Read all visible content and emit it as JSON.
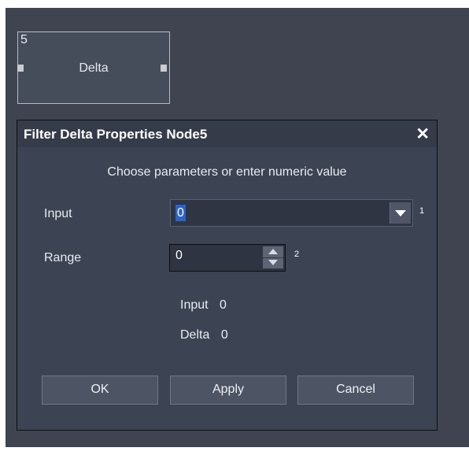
{
  "node": {
    "id": "5",
    "label": "Delta"
  },
  "dialog": {
    "title": "Filter Delta Properties Node5",
    "close_icon": "close-icon",
    "instruction": "Choose parameters or enter numeric value",
    "params": [
      {
        "label": "Input",
        "value": "0",
        "badge": "1",
        "control": "dropdown"
      },
      {
        "label": "Range",
        "value": "0",
        "badge": "2",
        "control": "spinner"
      }
    ],
    "readouts": [
      {
        "label": "Input",
        "value": "0"
      },
      {
        "label": "Delta",
        "value": "0"
      }
    ],
    "buttons": {
      "ok": "OK",
      "apply": "Apply",
      "cancel": "Cancel"
    }
  },
  "colors": {
    "background": "#3f4450",
    "dialog": "#3c4352",
    "selection": "#2c63c7"
  }
}
